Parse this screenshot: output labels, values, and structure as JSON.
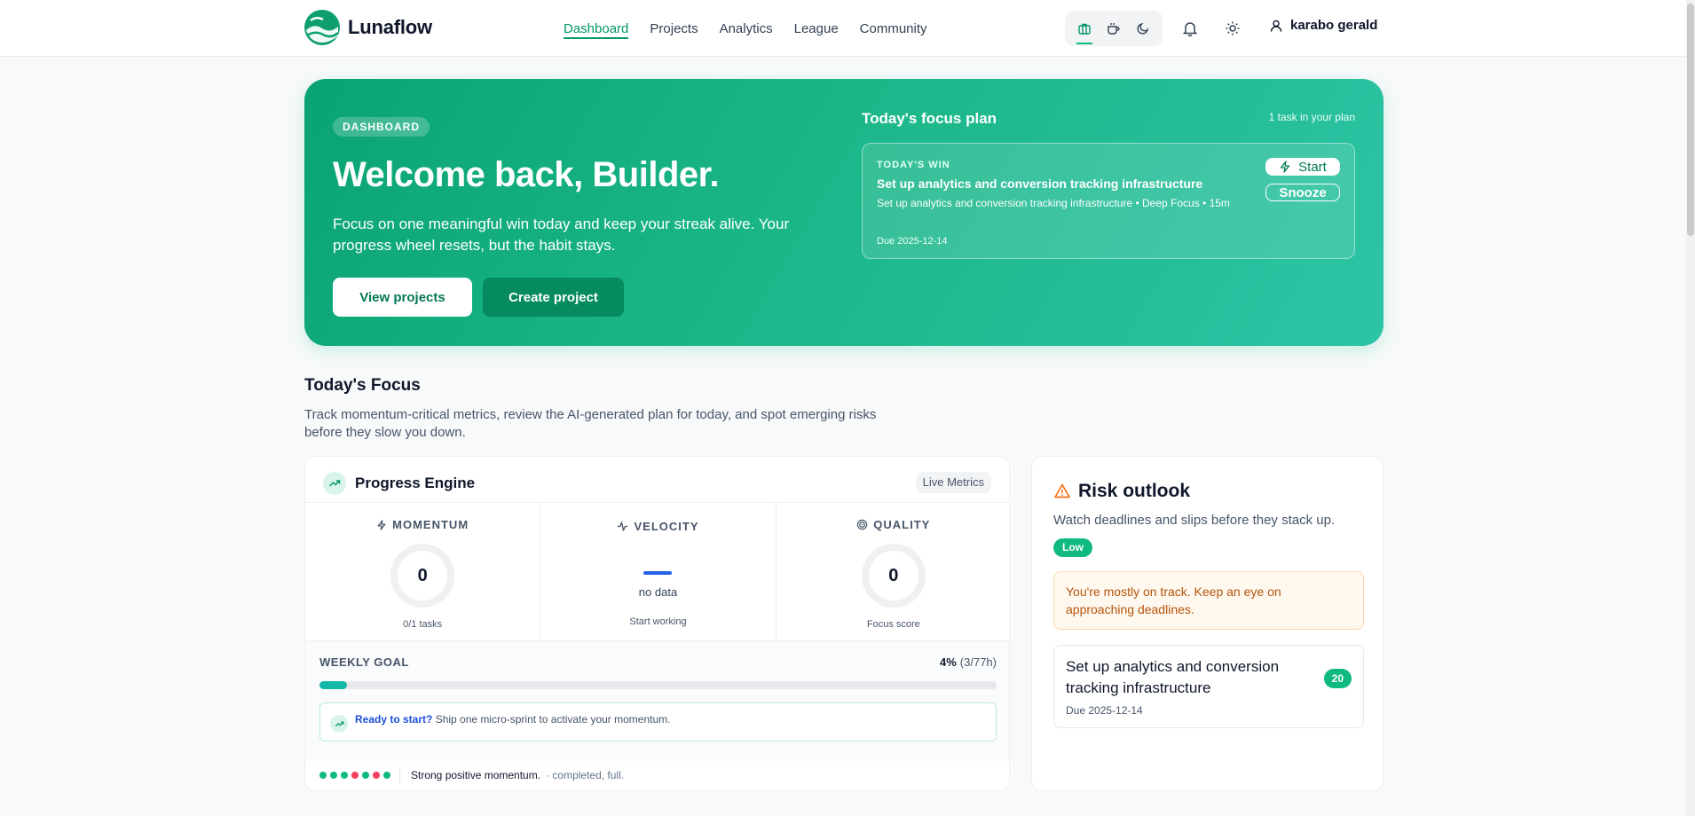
{
  "app": {
    "name": "Lunaflow"
  },
  "nav": {
    "items": [
      "Dashboard",
      "Projects",
      "Analytics",
      "League",
      "Community"
    ],
    "active": "Dashboard"
  },
  "header": {
    "user_name": "karabo gerald"
  },
  "icons": {
    "mode_buttons": [
      "briefcase-icon",
      "coffee-icon",
      "moon-icon"
    ],
    "notification": "bell-icon",
    "theme": "sun-icon",
    "user": "user-icon"
  },
  "hero": {
    "badge": "DASHBOARD",
    "title": "Welcome back, Builder.",
    "subtitle": "Focus on one meaningful win today and keep your streak alive. Your progress wheel resets, but the habit stays.",
    "primary_button": "View projects",
    "secondary_button": "Create project",
    "plan": {
      "title": "Today's focus plan",
      "count": "1 task in your plan",
      "kicker": "TODAY'S WIN",
      "task_title": "Set up analytics and conversion tracking infrastructure",
      "task_desc": "Set up analytics and conversion tracking infrastructure • Deep Focus • 15m",
      "due": "Due 2025-12-14",
      "start_label": "Start",
      "snooze_label": "Snooze"
    }
  },
  "focus": {
    "title": "Today's Focus",
    "description": "Track momentum-critical metrics, review the AI-generated plan for today, and spot emerging risks before they slow you down."
  },
  "engine": {
    "title": "Progress Engine",
    "badge": "Live Metrics",
    "momentum": {
      "label": "MOMENTUM",
      "value": "0",
      "foot": "0/1 tasks"
    },
    "velocity": {
      "label": "VELOCITY",
      "value": "no data",
      "foot": "Start working"
    },
    "quality": {
      "label": "QUALITY",
      "value": "0",
      "foot": "Focus score"
    },
    "weekly": {
      "label": "WEEKLY GOAL",
      "percent": "4%",
      "detail": "(3/77h)",
      "fill_fraction": 0.04
    },
    "ready": {
      "highlight": "Ready to start?",
      "text": "Ship one micro-sprint to activate your momentum."
    },
    "streak": {
      "dots": [
        "#10b981",
        "#10b981",
        "#10b981",
        "#f43f5e",
        "#10b981",
        "#f43f5e",
        "#10b981"
      ],
      "message": "Strong positive momentum.",
      "detail": "· completed, full."
    }
  },
  "risk": {
    "title": "Risk outlook",
    "description": "Watch deadlines and slips before they stack up.",
    "level": "Low",
    "alert": "You're mostly on track. Keep an eye on approaching deadlines.",
    "task": {
      "title": "Set up analytics and conversion tracking infrastructure",
      "due": "Due 2025-12-14",
      "score": "20"
    }
  },
  "colors": {
    "brand": "#059669",
    "accent": "#10b981",
    "danger": "#f43f5e",
    "warning": "#f97316",
    "velocity": "#2563eb"
  }
}
